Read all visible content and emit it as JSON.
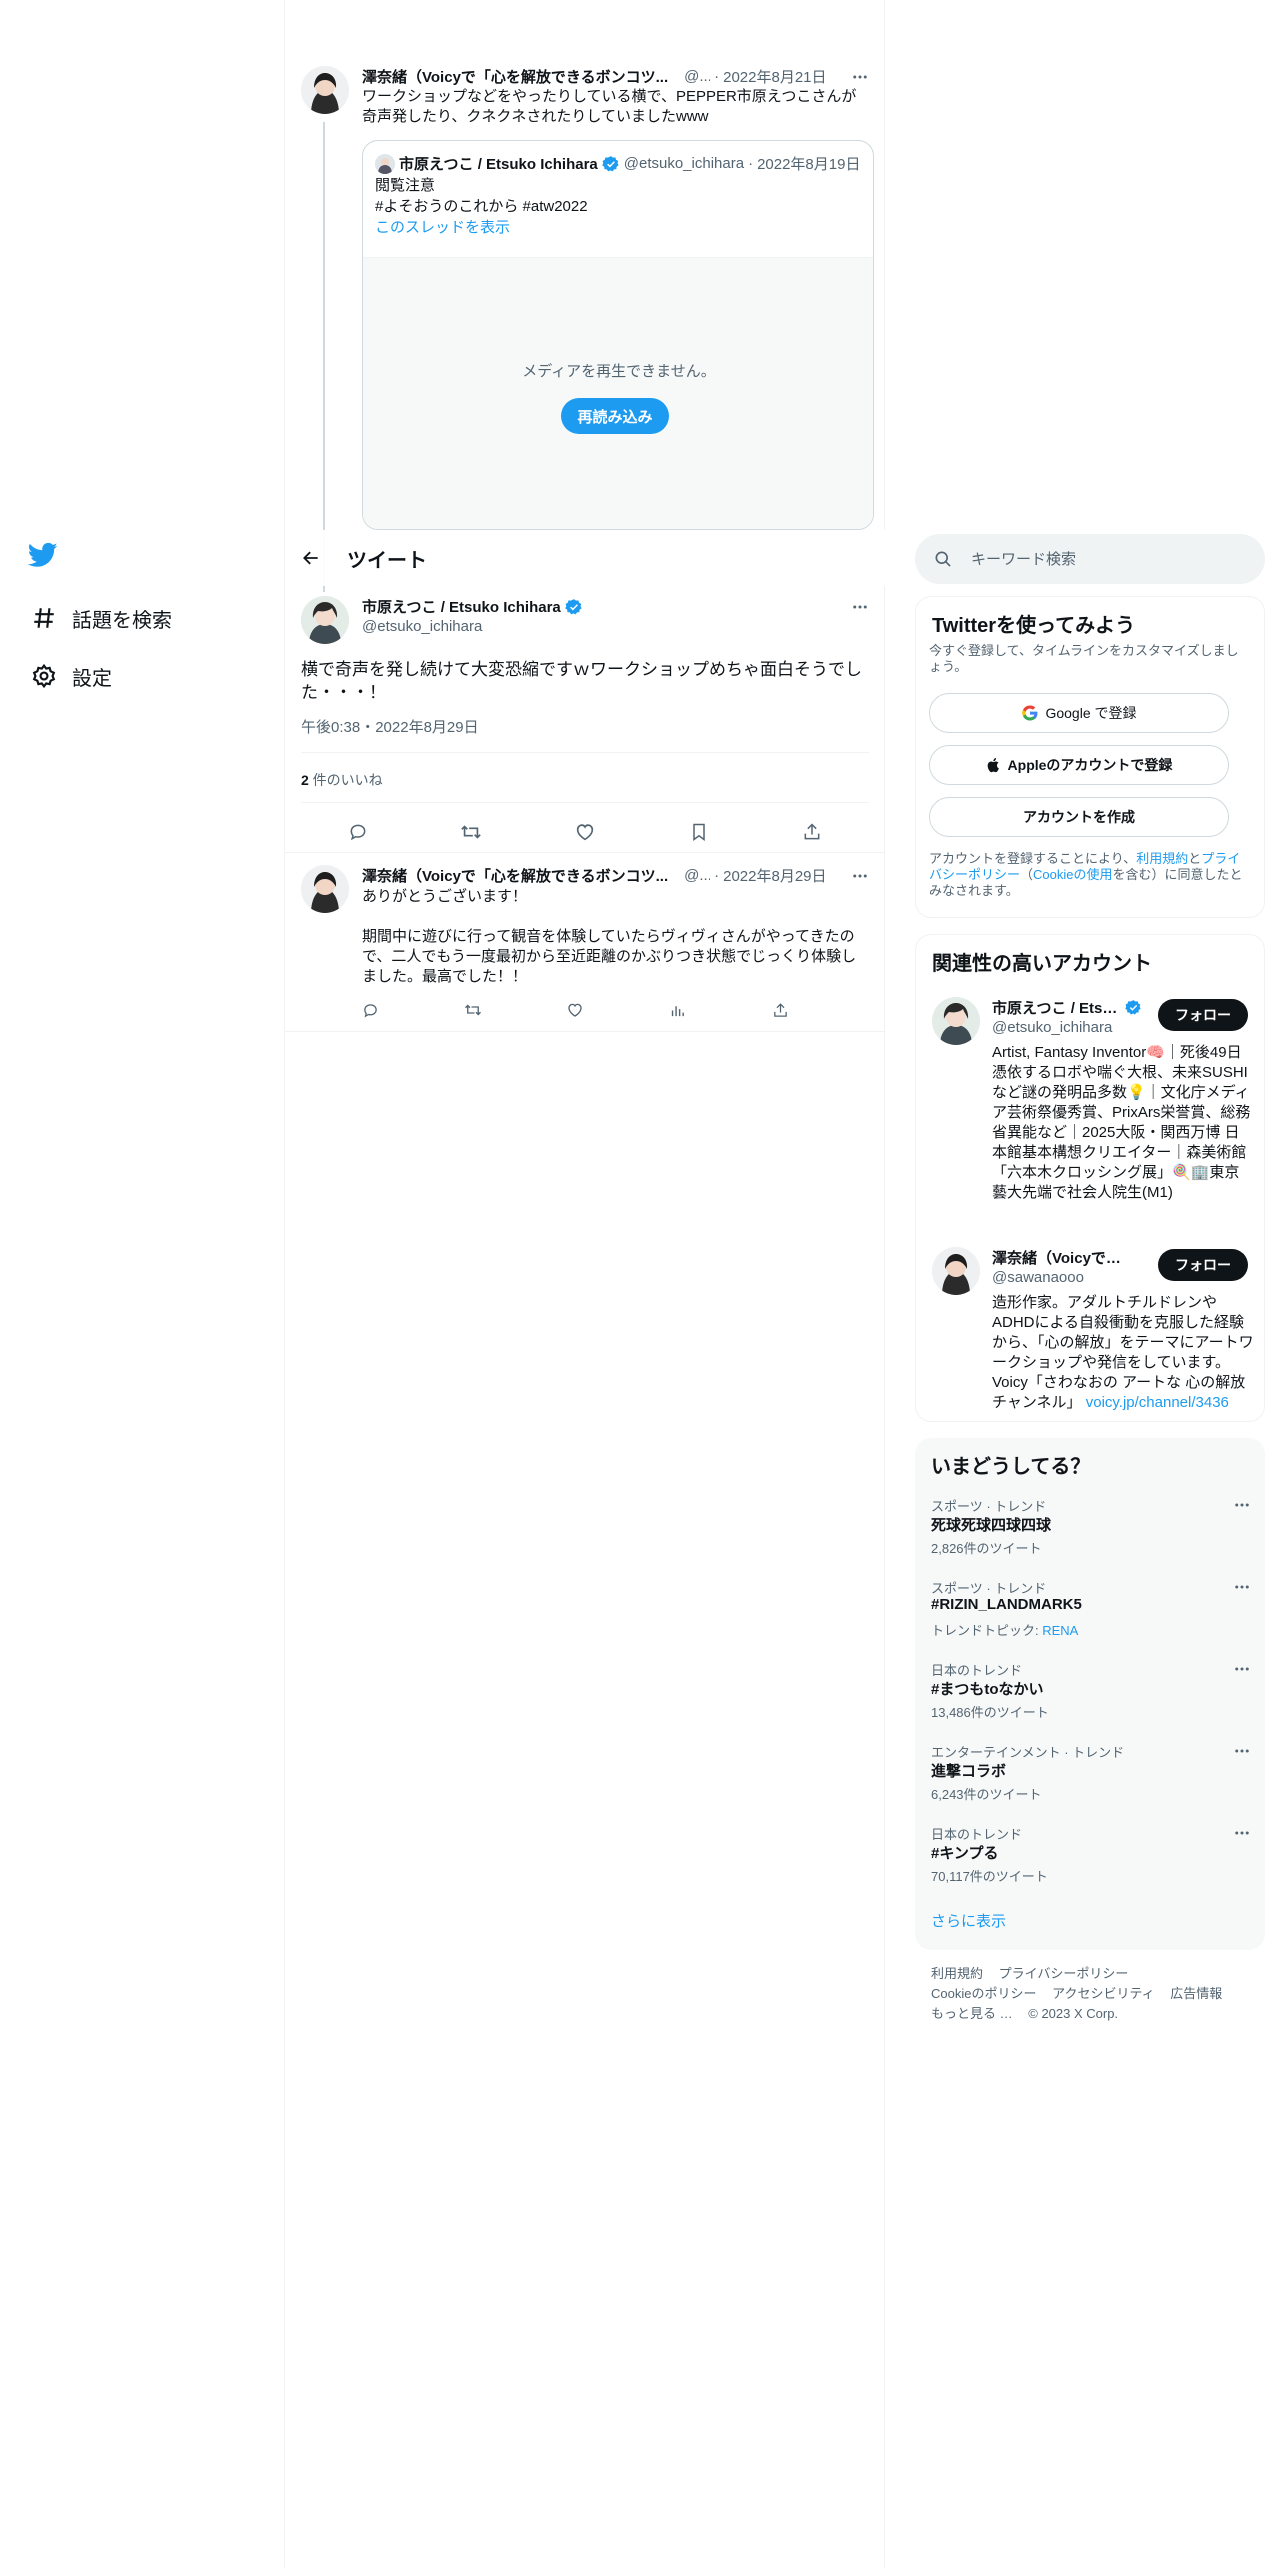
{
  "nav": {
    "explore_label": "話題を検索",
    "settings_label": "設定"
  },
  "thread_tweet": {
    "name": "澤奈緒（Voicyで「心を解放できるボンコツ...",
    "handle": "@...",
    "separator": "·",
    "date": "2022年8月21日",
    "text": "ワークショップなどをやったりしている横で、PEPPER市原えつこさんが奇声発したり、クネクネされたりしていましたwww",
    "quote": {
      "name": "市原えつこ / Etsuko Ichihara",
      "handle": "@etsuko_ichihara",
      "separator": "·",
      "date": "2022年8月19日",
      "line1": "閲覧注意",
      "line2": "#よそおうのこれから #atw2022",
      "thread_link": "このスレッドを表示",
      "media_error": "メディアを再生できません。",
      "reload_label": "再読み込み"
    }
  },
  "header": {
    "title": "ツイート"
  },
  "focal_tweet": {
    "name": "市原えつこ / Etsuko Ichihara",
    "handle": "@etsuko_ichihara",
    "text": "横で奇声を発し続けて大変恐縮ですｗワークショップめちゃ面白そうでした・・・！",
    "time": "午後0:38・2022年8月29日",
    "likes_count": "2",
    "likes_label": " 件のいいね"
  },
  "reply_tweet": {
    "name": "澤奈緒（Voicyで「心を解放できるボンコツ...",
    "handle": "@...",
    "separator": "·",
    "date": "2022年8月29日",
    "text1": "ありがとうございます！",
    "text2": "期間中に遊びに行って観音を体験していたらヴィヴィさんがやってきたので、二人でもう一度最初から至近距離のかぶりつき状態でじっくり体験しました。最高でした！！"
  },
  "search": {
    "placeholder": "キーワード検索"
  },
  "signup": {
    "title": "Twitterを使ってみよう",
    "desc": "今すぐ登録して、タイムラインをカスタマイズしましょう。",
    "google_label": "Google で登録",
    "apple_label": "Appleのアカウントで登録",
    "create_label": "アカウントを作成",
    "legal_pre": "アカウントを登録することにより、",
    "legal_terms": "利用規約",
    "legal_and": "と",
    "legal_privacy": "プライバシーポリシー",
    "legal_paren_open": "（",
    "legal_cookie": "Cookieの使用",
    "legal_post": "を含む）に同意したとみなされます。"
  },
  "related": {
    "title": "関連性の高いアカウント",
    "accounts": [
      {
        "name": "市原えつこ / Etsu...",
        "handle": "@etsuko_ichihara",
        "follow_label": "フォロー",
        "bio": "Artist, Fantasy Inventor🧠｜死後49日憑依するロボや喘ぐ大根、未来SUSHIなど謎の発明品多数💡｜文化庁メディア芸術祭優秀賞、PrixArs栄誉賞、総務省異能など｜2025大阪・関西万博 日本館基本構想クリエイター｜森美術館「六本木クロッシング展」🍭🏢東京藝大先端で社会人院生(M1)"
      },
      {
        "name": "澤奈緒（Voicyで「心...",
        "handle": "@sawanaooo",
        "follow_label": "フォロー",
        "bio": "造形作家。アダルトチルドレンやADHDによる自殺衝動を克服した経験から、「心の解放」をテーマにアートワークショップや発信をしています。Voicy「さわなおの アートな 心の解放チャンネル」",
        "bio_link": "voicy.jp/channel/3436"
      }
    ]
  },
  "trends": {
    "title": "いまどうしてる？",
    "items": [
      {
        "category": "スポーツ · トレンド",
        "name": "死球死球四球四球",
        "count": "2,826件のツイート"
      },
      {
        "category": "スポーツ · トレンド",
        "name": "#RIZIN_LANDMARK5",
        "topic_prefix": "トレンドトピック: ",
        "topic": "RENA"
      },
      {
        "category": "日本のトレンド",
        "name": "#まつもtoなかい",
        "count": "13,486件のツイート"
      },
      {
        "category": "エンターテインメント · トレンド",
        "name": "進撃コラボ",
        "count": "6,243件のツイート"
      },
      {
        "category": "日本のトレンド",
        "name": "#キンプる",
        "count": "70,117件のツイート"
      }
    ],
    "more_label": "さらに表示"
  },
  "footer": {
    "terms": "利用規約",
    "privacy": "プライバシーポリシー",
    "cookie": "Cookieのポリシー",
    "accessibility": "アクセシビリティ",
    "ads": "広告情報",
    "more": "もっと見る …",
    "copyright": "© 2023 X Corp."
  },
  "colors": {
    "accent": "#1d9bf0",
    "text": "#0f1419",
    "muted": "#536471",
    "border": "#eff3f4"
  }
}
